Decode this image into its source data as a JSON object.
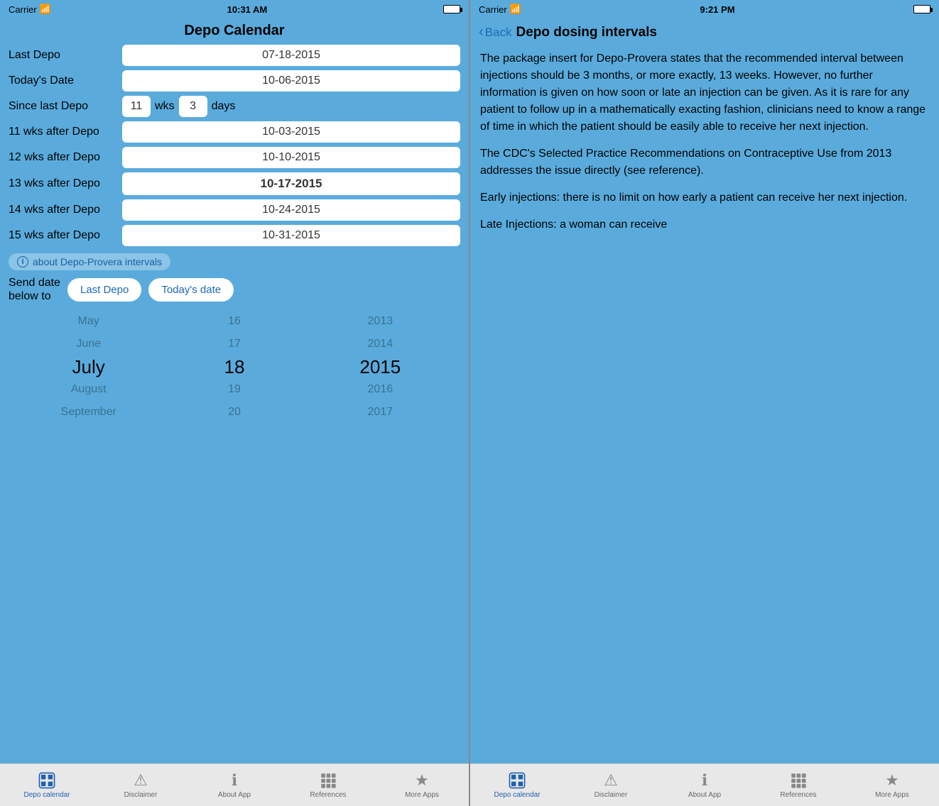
{
  "left_panel": {
    "status": {
      "carrier": "Carrier",
      "wifi": "📶",
      "time": "10:31 AM"
    },
    "title": "Depo Calendar",
    "rows": [
      {
        "label": "Last Depo",
        "value": "07-18-2015",
        "bold": false
      },
      {
        "label": "Today's Date",
        "value": "10-06-2015",
        "bold": false
      },
      {
        "label": "11 wks after Depo",
        "value": "10-03-2015",
        "bold": false
      },
      {
        "label": "12 wks after Depo",
        "value": "10-10-2015",
        "bold": false
      },
      {
        "label": "13 wks after Depo",
        "value": "10-17-2015",
        "bold": true
      },
      {
        "label": "14 wks after Depo",
        "value": "10-24-2015",
        "bold": false
      },
      {
        "label": "15 wks after Depo",
        "value": "10-31-2015",
        "bold": false
      }
    ],
    "since_last_depo": {
      "label": "Since last Depo",
      "weeks": "11",
      "weeks_unit": "wks",
      "days": "3",
      "days_unit": "days"
    },
    "info_link": "about Depo-Provera intervals",
    "send_date_label": "Send date\nbelow to",
    "send_btn_last": "Last Depo",
    "send_btn_today": "Today's date",
    "picker": {
      "months": [
        "May",
        "June",
        "July",
        "August",
        "September"
      ],
      "days": [
        "16",
        "17",
        "18",
        "19",
        "20"
      ],
      "years": [
        "2013",
        "2014",
        "2015",
        "2016",
        "2017"
      ]
    },
    "tabs": [
      {
        "id": "depo-calendar",
        "label": "Depo calendar",
        "active": true
      },
      {
        "id": "disclaimer",
        "label": "Disclaimer",
        "active": false
      },
      {
        "id": "about-app",
        "label": "About App",
        "active": false
      },
      {
        "id": "references",
        "label": "References",
        "active": false
      },
      {
        "id": "more-apps",
        "label": "More Apps",
        "active": false
      }
    ]
  },
  "right_panel": {
    "status": {
      "carrier": "Carrier",
      "time": "9:21 PM"
    },
    "back_label": "Back",
    "title": "Depo dosing intervals",
    "paragraphs": [
      "The package insert for Depo-Provera states that the recommended interval between injections should be 3 months, or more exactly, 13 weeks. However, no further information is given on how soon or late an injection can be given.  As it is rare for any patient to follow up in a mathematically exacting fashion, clinicians need to know a range of time in which the patient should be easily able to receive her next injection.",
      "The CDC's Selected Practice Recommendations on Contraceptive Use from 2013 addresses the issue directly (see reference).",
      "Early injections:  there is no limit on how early a patient can receive her next injection.",
      "Late Injections:  a woman can receive"
    ],
    "tabs": [
      {
        "id": "depo-calendar",
        "label": "Depo calendar",
        "active": true
      },
      {
        "id": "disclaimer",
        "label": "Disclaimer",
        "active": false
      },
      {
        "id": "about-app",
        "label": "About App",
        "active": false
      },
      {
        "id": "references",
        "label": "References",
        "active": false
      },
      {
        "id": "more-apps",
        "label": "More Apps",
        "active": false
      }
    ]
  }
}
